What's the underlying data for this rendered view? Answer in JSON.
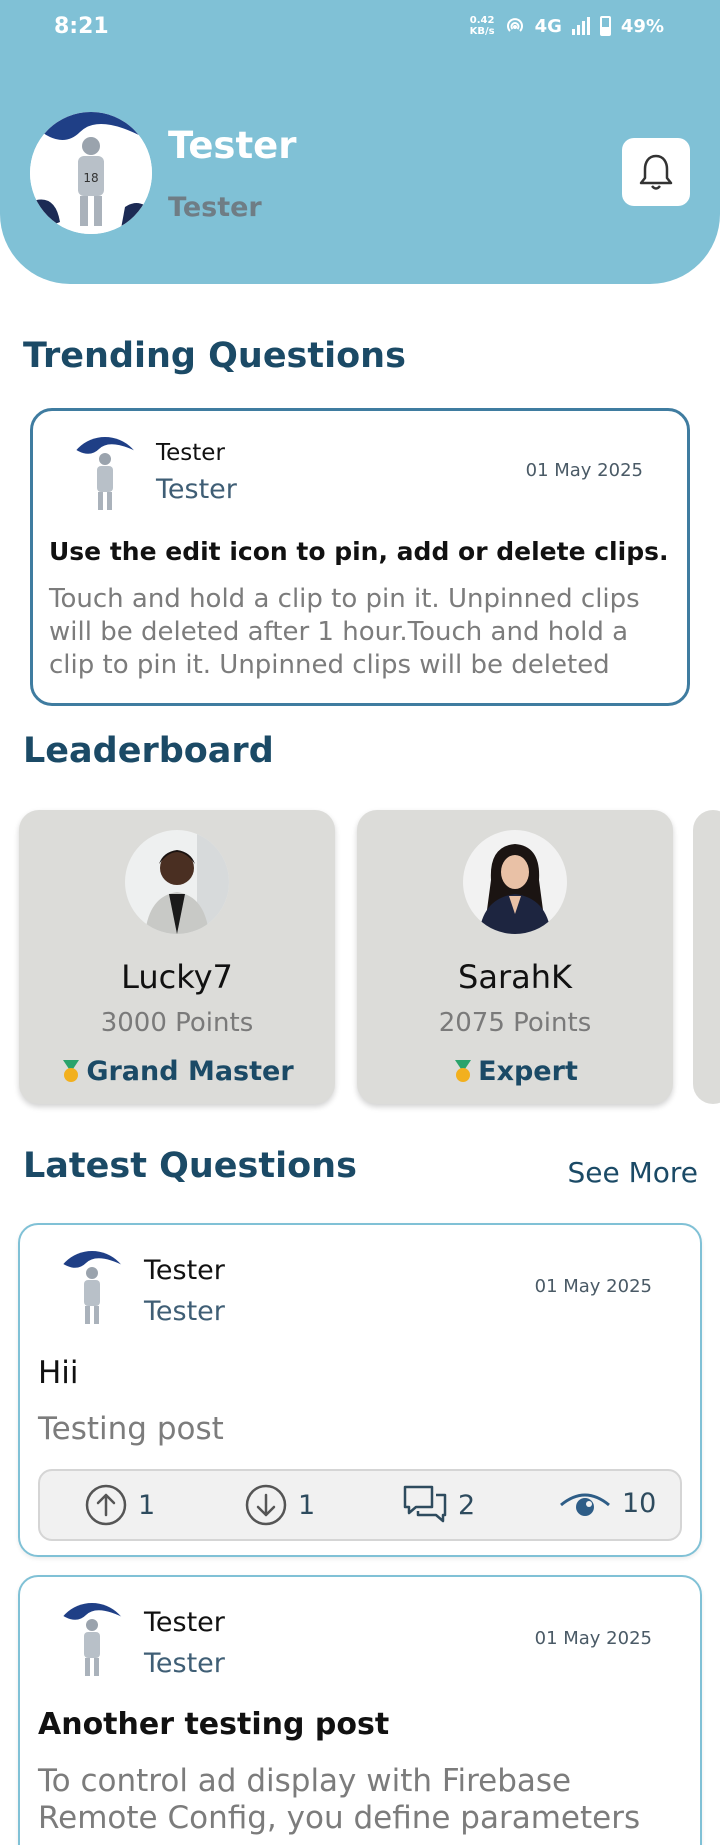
{
  "status_bar": {
    "time": "8:21",
    "net_speed_value": "0.42",
    "net_speed_unit": "KB/s",
    "network": "4G",
    "battery": "49%"
  },
  "profile": {
    "name": "Tester",
    "role": "Tester"
  },
  "trending": {
    "title": "Trending Questions",
    "card": {
      "author": "Tester",
      "role": "Tester",
      "date": "01 May 2025",
      "question": "Use the edit icon to pin, add or delete clips.",
      "body": "Touch and hold a clip to pin it. Unpinned clips will be deleted after 1 hour.Touch and hold a clip to pin it. Unpinned clips will be deleted"
    }
  },
  "leaderboard": {
    "title": "Leaderboard",
    "users": [
      {
        "name": "Lucky7",
        "points": "3000 Points",
        "rank": "Grand Master"
      },
      {
        "name": "SarahK",
        "points": "2075 Points",
        "rank": "Expert"
      }
    ]
  },
  "latest": {
    "title": "Latest Questions",
    "see_more": "See More",
    "questions": [
      {
        "author": "Tester",
        "role": "Tester",
        "date": "01 May 2025",
        "title": "Hii",
        "body": "Testing post",
        "upvotes": "1",
        "downvotes": "1",
        "comments": "2",
        "views": "10"
      },
      {
        "author": "Tester",
        "role": "Tester",
        "date": "01 May 2025",
        "title": "Another testing post",
        "body": "To control ad display with Firebase Remote Config, you define parameters"
      }
    ]
  },
  "colors": {
    "header_bg": "#80c1d6",
    "title_text": "#1b4a66",
    "trend_border": "#3f7ca0",
    "leader_card_bg": "#dcdcd9"
  }
}
